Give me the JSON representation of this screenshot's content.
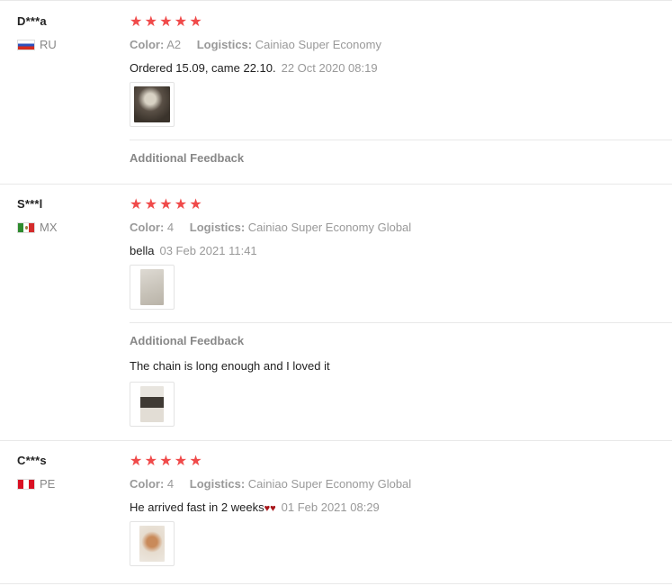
{
  "reviews": [
    {
      "user": "D***a",
      "country": "RU",
      "stars": 5,
      "color_label": "Color:",
      "color_value": "A2",
      "logistics_label": "Logistics:",
      "logistics_value": "Cainiao Super Economy",
      "text": "Ordered 15.09, came 22.10.",
      "date": "22 Oct 2020 08:19",
      "additional_label": "Additional Feedback"
    },
    {
      "user": "S***l",
      "country": "MX",
      "stars": 5,
      "color_label": "Color:",
      "color_value": "4",
      "logistics_label": "Logistics:",
      "logistics_value": "Cainiao Super Economy Global",
      "text": "bella",
      "date": "03 Feb 2021 11:41",
      "additional_label": "Additional Feedback",
      "additional_text": "The chain is long enough and I loved it"
    },
    {
      "user": "C***s",
      "country": "PE",
      "stars": 5,
      "color_label": "Color:",
      "color_value": "4",
      "logistics_label": "Logistics:",
      "logistics_value": "Cainiao Super Economy Global",
      "text": "He arrived fast in 2 weeks",
      "hearts": "♥♥",
      "date": "01 Feb 2021 08:29"
    }
  ],
  "star_glyph": "★",
  "star_color": "#f04a4a"
}
